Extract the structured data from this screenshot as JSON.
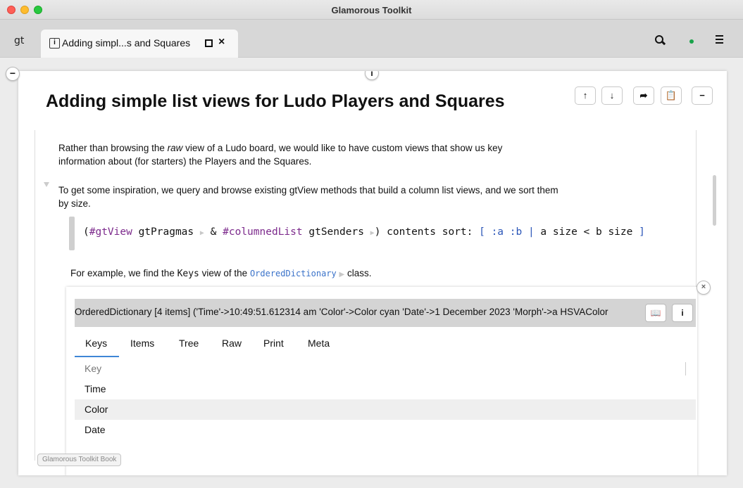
{
  "window": {
    "title": "Glamorous Toolkit"
  },
  "tabbar": {
    "logo": "gt",
    "active_tab": {
      "icon": "page-info-icon",
      "label": "Adding simpl...s and Squares"
    }
  },
  "page": {
    "title": "Adding simple list views for Ludo Players and Squares",
    "actions": [
      "up-arrow-icon",
      "down-arrow-icon",
      "share-icon",
      "clipboard-icon",
      "minus-icon"
    ],
    "para1_pre": "Rather than browsing the ",
    "para1_em": "raw",
    "para1_post": " view of a Ludo board, we would like to have custom views that show us key information about (for starters) the Players and the Squares.",
    "para2": "To get some inspiration, we query and browse existing gtView methods that build a column list views, and we sort them by size.",
    "code": {
      "open": "(",
      "sym1": "#gtView",
      "msg1": " gtPragmas",
      "amp": " & ",
      "sym2": "#columnedList",
      "msg2": " gtSenders",
      "close": ") contents sort: ",
      "block_open": "[ :a :b |",
      "block_body": " a size < b size ",
      "block_close": "]"
    },
    "para3_pre": "For example, we find the ",
    "para3_keys": "Keys",
    "para3_mid": " view of the ",
    "para3_class": "OrderedDictionary",
    "para3_post": " class."
  },
  "inspector": {
    "header": "OrderedDictionary [4 items] ('Time'->10:49:51.612314 am 'Color'->Color cyan 'Date'->1 December 2023 'Morph'->a HSVAColor",
    "tabs": [
      "Keys",
      "Items",
      "Tree",
      "Raw",
      "Print",
      "Meta"
    ],
    "active_tab": "Keys",
    "column_header": "Key",
    "rows": [
      "Time",
      "Color",
      "Date"
    ]
  },
  "footer": {
    "chip": "Glamorous Toolkit Book"
  }
}
